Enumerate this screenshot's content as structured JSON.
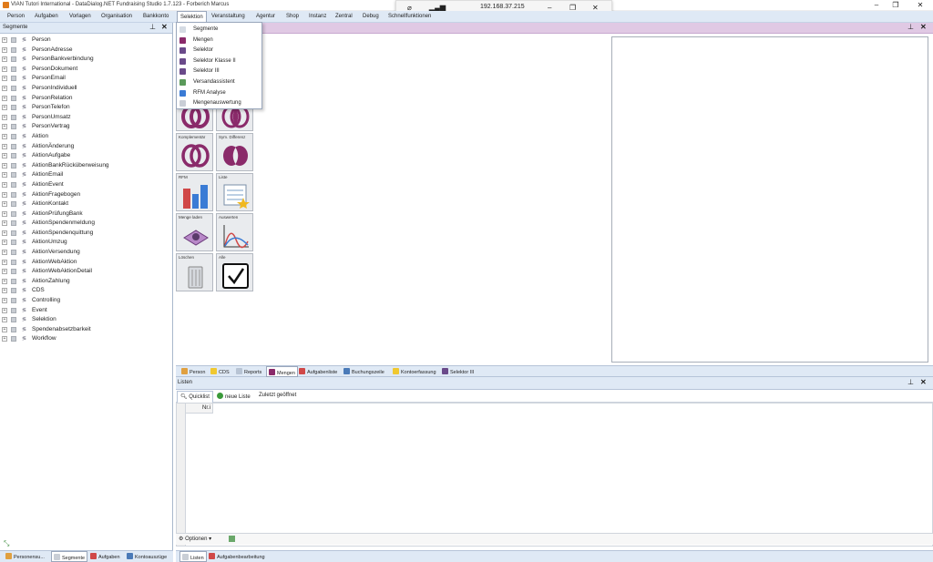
{
  "window": {
    "title": "VIAN Tutori International - DataDialog.NET Fundraising Studio 1.7.123 - Forberich Marcus"
  },
  "remote": {
    "ip": "192.168.37.215"
  },
  "menu": [
    "Person",
    "Aufgaben",
    "Vorlagen",
    "Organisation",
    "Bankkonto",
    "Selektion",
    "Veranstaltung",
    "Agentur",
    "Shop",
    "Instanz",
    "Zentral",
    "Debug",
    "Schnellfunktionen"
  ],
  "segpanel": {
    "title": "Segmente"
  },
  "tree": [
    "Person",
    "PersonAdresse",
    "PersonBankverbindung",
    "PersonDokument",
    "PersonEmail",
    "PersonIndividuell",
    "PersonRelation",
    "PersonTelefon",
    "PersonUmsatz",
    "PersonVertrag",
    "Aktion",
    "AktionÄnderung",
    "AktionAufgabe",
    "AktionBankRücküberweisung",
    "AktionEmail",
    "AktionEvent",
    "AktionFragebogen",
    "AktionKontakt",
    "AktionPrüfungBank",
    "AktionSpendenmeldung",
    "AktionSpendenquittung",
    "AktionUmzug",
    "AktionVersendung",
    "AktionWebAktion",
    "AktionWebAktionDetail",
    "AktionZahlung",
    "CDS",
    "Controlling",
    "Event",
    "Selektion",
    "Spendenabsetzbarkeit",
    "Workflow"
  ],
  "dropdown": [
    "Segmente",
    "Mengen",
    "Selektor",
    "Selektor Klasse II",
    "Selektor III",
    "Versandassistent",
    "RFM Analyse",
    "Mengenauswertung"
  ],
  "tiles": [
    "Komplementär",
    "Sym. Differenz",
    "RFM",
    "Liste",
    "Menge laden",
    "Auswerten",
    "Löschen",
    "Alle"
  ],
  "midtabs": [
    "Person",
    "CDS",
    "Reports",
    "Mengen",
    "Aufgabenliste",
    "Buchungszeile",
    "Kontoerfassung",
    "Selektor III"
  ],
  "listen": {
    "title": "Listen",
    "subtabs": [
      "Quicklist",
      "neue Liste",
      "Zuletzt geöffnet"
    ],
    "column": "Nr.i",
    "options": "Optionen"
  },
  "bottomtabsL": [
    "Personensu...",
    "Segmente",
    "Aufgaben",
    "Kontoauszüge"
  ],
  "bottomtabsR": [
    "Listen",
    "Aufgabenbearbeitung"
  ],
  "colors": {
    "accent": "#dfe9f5",
    "center_header": "#e0c9e4",
    "set_icon": "#8a2a6a"
  }
}
